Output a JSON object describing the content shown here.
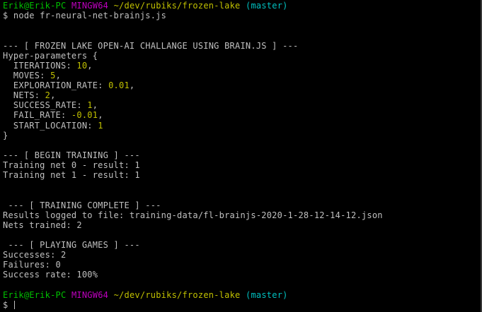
{
  "prompt1": {
    "user": "Erik@Erik-PC",
    "system": "MINGW64",
    "path": "~/dev/rubiks/frozen-lake",
    "branch": "(master)"
  },
  "command_line": "$ node fr-neural-net-brainjs.js",
  "header_title": "--- [ FROZEN LAKE OPEN-AI CHALLANGE USING BRAIN.JS ] ---",
  "hyper_open": "Hyper-parameters {",
  "params": [
    {
      "key": "  ITERATIONS: ",
      "value": "10",
      "sep": ","
    },
    {
      "key": "  MOVES: ",
      "value": "5",
      "sep": ","
    },
    {
      "key": "  EXPLORATION_RATE: ",
      "value": "0.01",
      "sep": ","
    },
    {
      "key": "  NETS: ",
      "value": "2",
      "sep": ","
    },
    {
      "key": "  SUCCESS_RATE: ",
      "value": "1",
      "sep": ","
    },
    {
      "key": "  FAIL_RATE: ",
      "value": "-0.01",
      "sep": ","
    },
    {
      "key": "  START_LOCATION: ",
      "value": "1",
      "sep": ""
    }
  ],
  "hyper_close": "}",
  "begin_training": "--- [ BEGIN TRAINING ] ---",
  "training_results": [
    "Training net 0 - result: 1",
    "Training net 1 - result: 1"
  ],
  "training_complete": " --- [ TRAINING COMPLETE ] ---",
  "results_logged": "Results logged to file: training-data/fl-brainjs-2020-1-28-12-14-12.json",
  "nets_trained": "Nets trained: 2",
  "playing_games": " --- [ PLAYING GAMES ] ---",
  "successes": "Successes: 2",
  "failures": "Failures: 0",
  "success_rate": "Success rate: 100%",
  "prompt2": {
    "user": "Erik@Erik-PC",
    "system": "MINGW64",
    "path": "~/dev/rubiks/frozen-lake",
    "branch": "(master)"
  },
  "input_prompt": "$ "
}
